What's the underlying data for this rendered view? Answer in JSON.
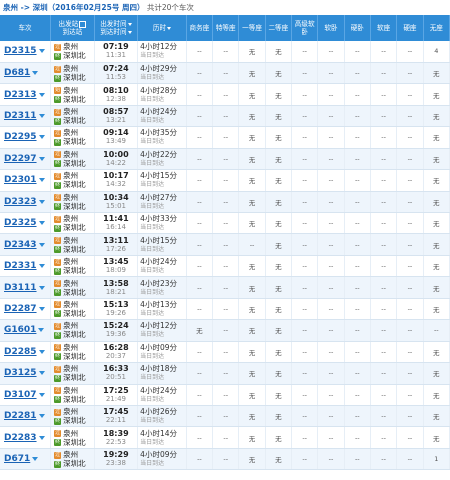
{
  "header": {
    "route": "泉州 -> 深圳（2016年02月25号 周四）",
    "count": "共计20个车次"
  },
  "columns": {
    "train": "车次",
    "station_top": "出发站",
    "station_bottom": "到达站",
    "time_top": "出发时间",
    "time_bottom": "到达时间",
    "duration": "历时",
    "seats": [
      "商务座",
      "特等座",
      "一等座",
      "二等座",
      "高级软卧",
      "软卧",
      "硬卧",
      "软座",
      "硬座",
      "无座"
    ]
  },
  "badges": {
    "start": "始",
    "pass": "过",
    "end": "终"
  },
  "trains": [
    {
      "code": "D2315",
      "from_badge": "过",
      "from": "泉州",
      "to_badge": "终",
      "to": "深圳北",
      "dep": "07:19",
      "arr": "11:31",
      "duration": "4小时12分",
      "arrive": "当日到达",
      "seats": [
        "--",
        "--",
        "无",
        "无",
        "--",
        "--",
        "--",
        "--",
        "--",
        "4"
      ]
    },
    {
      "code": "D681",
      "from_badge": "过",
      "from": "泉州",
      "to_badge": "终",
      "to": "深圳北",
      "dep": "07:24",
      "arr": "11:53",
      "duration": "4小时29分",
      "arrive": "当日到达",
      "seats": [
        "--",
        "--",
        "无",
        "无",
        "--",
        "--",
        "--",
        "--",
        "--",
        "无"
      ]
    },
    {
      "code": "D2313",
      "from_badge": "始",
      "from": "泉州",
      "to_badge": "终",
      "to": "深圳北",
      "dep": "08:10",
      "arr": "12:38",
      "duration": "4小时28分",
      "arrive": "当日到达",
      "seats": [
        "--",
        "--",
        "无",
        "无",
        "--",
        "--",
        "--",
        "--",
        "--",
        "无"
      ]
    },
    {
      "code": "D2311",
      "from_badge": "过",
      "from": "泉州",
      "to_badge": "终",
      "to": "深圳北",
      "dep": "08:57",
      "arr": "13:21",
      "duration": "4小时24分",
      "arrive": "当日到达",
      "seats": [
        "--",
        "--",
        "无",
        "无",
        "--",
        "--",
        "--",
        "--",
        "--",
        "无"
      ]
    },
    {
      "code": "D2295",
      "from_badge": "过",
      "from": "泉州",
      "to_badge": "终",
      "to": "深圳北",
      "dep": "09:14",
      "arr": "13:49",
      "duration": "4小时35分",
      "arrive": "当日到达",
      "seats": [
        "--",
        "--",
        "无",
        "无",
        "--",
        "--",
        "--",
        "--",
        "--",
        "无"
      ]
    },
    {
      "code": "D2297",
      "from_badge": "过",
      "from": "泉州",
      "to_badge": "终",
      "to": "深圳北",
      "dep": "10:00",
      "arr": "14:22",
      "duration": "4小时22分",
      "arrive": "当日到达",
      "seats": [
        "--",
        "--",
        "无",
        "无",
        "--",
        "--",
        "--",
        "--",
        "--",
        "无"
      ]
    },
    {
      "code": "D2301",
      "from_badge": "过",
      "from": "泉州",
      "to_badge": "终",
      "to": "深圳北",
      "dep": "10:17",
      "arr": "14:32",
      "duration": "4小时15分",
      "arrive": "当日到达",
      "seats": [
        "--",
        "--",
        "无",
        "无",
        "--",
        "--",
        "--",
        "--",
        "--",
        "无"
      ]
    },
    {
      "code": "D2323",
      "from_badge": "过",
      "from": "泉州",
      "to_badge": "终",
      "to": "深圳北",
      "dep": "10:34",
      "arr": "15:01",
      "duration": "4小时27分",
      "arrive": "当日到达",
      "seats": [
        "--",
        "--",
        "无",
        "无",
        "--",
        "--",
        "--",
        "--",
        "--",
        "无"
      ]
    },
    {
      "code": "D2325",
      "from_badge": "过",
      "from": "泉州",
      "to_badge": "终",
      "to": "深圳北",
      "dep": "11:41",
      "arr": "16:14",
      "duration": "4小时33分",
      "arrive": "当日到达",
      "seats": [
        "--",
        "--",
        "无",
        "无",
        "--",
        "--",
        "--",
        "--",
        "--",
        "无"
      ]
    },
    {
      "code": "D2343",
      "from_badge": "过",
      "from": "泉州",
      "to_badge": "终",
      "to": "深圳北",
      "dep": "13:11",
      "arr": "17:26",
      "duration": "4小时15分",
      "arrive": "当日到达",
      "seats": [
        "--",
        "--",
        "--",
        "无",
        "--",
        "--",
        "--",
        "--",
        "--",
        "无"
      ]
    },
    {
      "code": "D2331",
      "from_badge": "过",
      "from": "泉州",
      "to_badge": "终",
      "to": "深圳北",
      "dep": "13:45",
      "arr": "18:09",
      "duration": "4小时24分",
      "arrive": "当日到达",
      "seats": [
        "--",
        "--",
        "无",
        "无",
        "--",
        "--",
        "--",
        "--",
        "--",
        "无"
      ]
    },
    {
      "code": "D3111",
      "from_badge": "过",
      "from": "泉州",
      "to_badge": "终",
      "to": "深圳北",
      "dep": "13:58",
      "arr": "18:21",
      "duration": "4小时23分",
      "arrive": "当日到达",
      "seats": [
        "--",
        "--",
        "无",
        "无",
        "--",
        "--",
        "--",
        "--",
        "--",
        "无"
      ]
    },
    {
      "code": "D2287",
      "from_badge": "过",
      "from": "泉州",
      "to_badge": "终",
      "to": "深圳北",
      "dep": "15:13",
      "arr": "19:26",
      "duration": "4小时13分",
      "arrive": "当日到达",
      "seats": [
        "--",
        "--",
        "无",
        "无",
        "--",
        "--",
        "--",
        "--",
        "--",
        "无"
      ]
    },
    {
      "code": "G1601",
      "from_badge": "过",
      "from": "泉州",
      "to_badge": "终",
      "to": "深圳北",
      "dep": "15:24",
      "arr": "19:36",
      "duration": "4小时12分",
      "arrive": "当日到达",
      "seats": [
        "无",
        "--",
        "无",
        "无",
        "--",
        "--",
        "--",
        "--",
        "--",
        "--"
      ]
    },
    {
      "code": "D2285",
      "from_badge": "过",
      "from": "泉州",
      "to_badge": "终",
      "to": "深圳北",
      "dep": "16:28",
      "arr": "20:37",
      "duration": "4小时09分",
      "arrive": "当日到达",
      "seats": [
        "--",
        "--",
        "无",
        "无",
        "--",
        "--",
        "--",
        "--",
        "--",
        "无"
      ]
    },
    {
      "code": "D3125",
      "from_badge": "过",
      "from": "泉州",
      "to_badge": "终",
      "to": "深圳北",
      "dep": "16:33",
      "arr": "20:51",
      "duration": "4小时18分",
      "arrive": "当日到达",
      "seats": [
        "--",
        "--",
        "无",
        "无",
        "--",
        "--",
        "--",
        "--",
        "--",
        "无"
      ]
    },
    {
      "code": "D3107",
      "from_badge": "过",
      "from": "泉州",
      "to_badge": "终",
      "to": "深圳北",
      "dep": "17:25",
      "arr": "21:49",
      "duration": "4小时24分",
      "arrive": "当日到达",
      "seats": [
        "--",
        "--",
        "无",
        "无",
        "--",
        "--",
        "--",
        "--",
        "--",
        "无"
      ]
    },
    {
      "code": "D2281",
      "from_badge": "过",
      "from": "泉州",
      "to_badge": "终",
      "to": "深圳北",
      "dep": "17:45",
      "arr": "22:11",
      "duration": "4小时26分",
      "arrive": "当日到达",
      "seats": [
        "--",
        "--",
        "无",
        "无",
        "--",
        "--",
        "--",
        "--",
        "--",
        "无"
      ]
    },
    {
      "code": "D2283",
      "from_badge": "过",
      "from": "泉州",
      "to_badge": "终",
      "to": "深圳北",
      "dep": "18:39",
      "arr": "22:53",
      "duration": "4小时14分",
      "arrive": "当日到达",
      "seats": [
        "--",
        "--",
        "无",
        "无",
        "--",
        "--",
        "--",
        "--",
        "--",
        "无"
      ]
    },
    {
      "code": "D671",
      "from_badge": "过",
      "from": "泉州",
      "to_badge": "终",
      "to": "深圳北",
      "dep": "19:29",
      "arr": "23:38",
      "duration": "4小时09分",
      "arrive": "当日到达",
      "seats": [
        "--",
        "--",
        "无",
        "无",
        "--",
        "--",
        "--",
        "--",
        "--",
        "1"
      ]
    }
  ]
}
